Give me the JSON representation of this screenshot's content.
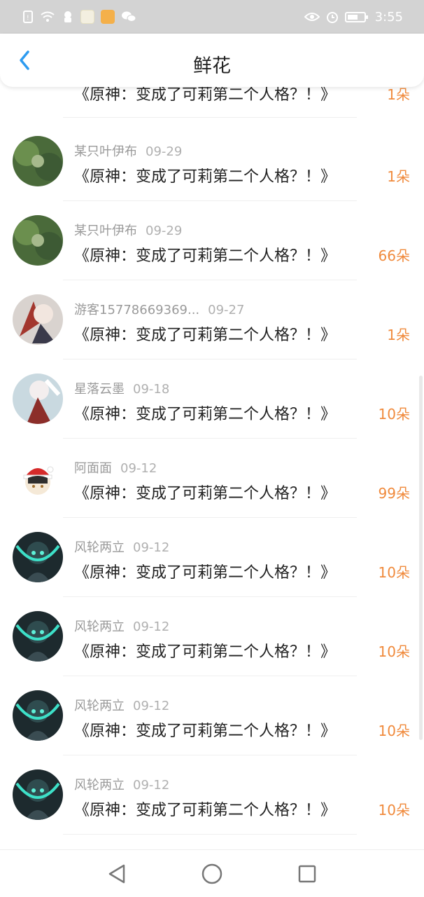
{
  "status_bar": {
    "time": "3:55"
  },
  "header": {
    "title": "鲜花"
  },
  "colors": {
    "accent": "#2d9bf0",
    "flower_count": "#f08a3c",
    "status_bar_bg": "#d3d3d3"
  },
  "rows": [
    {
      "user": "",
      "date": "",
      "work": "《原神：变成了可莉第二个人格？！》",
      "count": "1朵",
      "avatar": "forest-avatar"
    },
    {
      "user": "某只叶伊布",
      "date": "09-29",
      "work": "《原神：变成了可莉第二个人格？！》",
      "count": "1朵",
      "avatar": "forest-avatar"
    },
    {
      "user": "某只叶伊布",
      "date": "09-29",
      "work": "《原神：变成了可莉第二个人格？！》",
      "count": "66朵",
      "avatar": "forest-avatar"
    },
    {
      "user": "游客15778669369...",
      "date": "09-27",
      "work": "《原神：变成了可莉第二个人格？！》",
      "count": "1朵",
      "avatar": "anime-avatar"
    },
    {
      "user": "星落云墨",
      "date": "09-18",
      "work": "《原神：变成了可莉第二个人格？！》",
      "count": "10朵",
      "avatar": "anime-white-avatar"
    },
    {
      "user": "阿面面",
      "date": "09-12",
      "work": "《原神：变成了可莉第二个人格？！》",
      "count": "99朵",
      "avatar": "santa-avatar"
    },
    {
      "user": "风轮两立",
      "date": "09-12",
      "work": "《原神：变成了可莉第二个人格？！》",
      "count": "10朵",
      "avatar": "dark-teal-avatar"
    },
    {
      "user": "风轮两立",
      "date": "09-12",
      "work": "《原神：变成了可莉第二个人格？！》",
      "count": "10朵",
      "avatar": "dark-teal-avatar"
    },
    {
      "user": "风轮两立",
      "date": "09-12",
      "work": "《原神：变成了可莉第二个人格？！》",
      "count": "10朵",
      "avatar": "dark-teal-avatar"
    },
    {
      "user": "风轮两立",
      "date": "09-12",
      "work": "《原神：变成了可莉第二个人格？！》",
      "count": "10朵",
      "avatar": "dark-teal-avatar"
    }
  ],
  "navbar": {
    "icons": [
      "back-triangle-icon",
      "home-circle-icon",
      "recents-square-icon"
    ]
  }
}
